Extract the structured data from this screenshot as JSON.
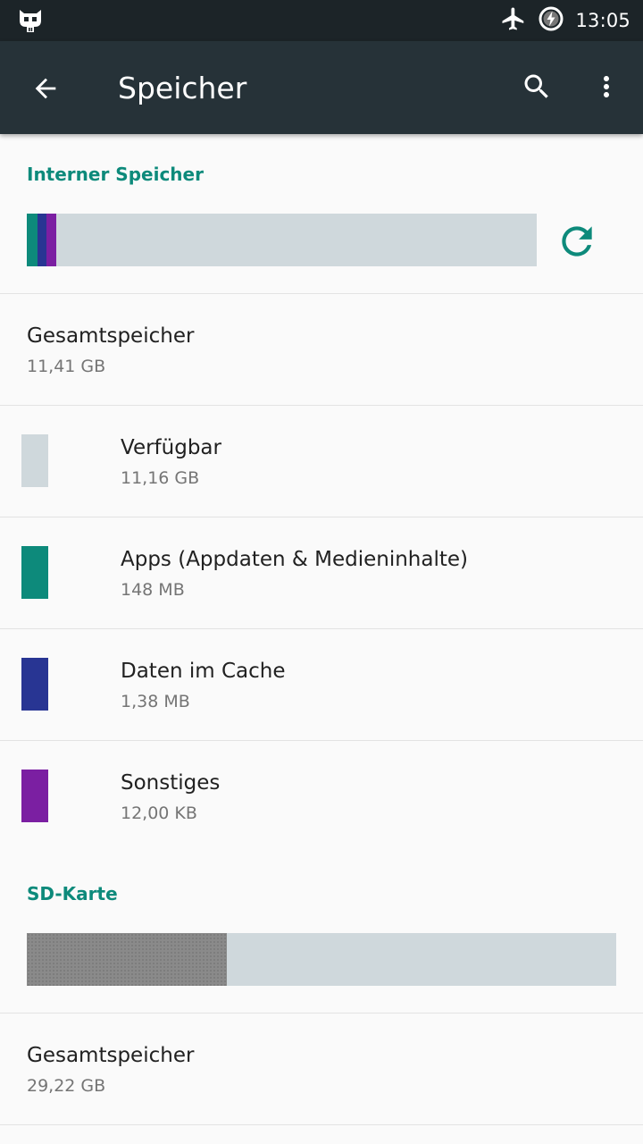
{
  "status_bar": {
    "time": "13:05",
    "left_icon": "cyanogenmod-icon",
    "right_icons": [
      "airplane-mode-icon",
      "battery-charging-icon"
    ]
  },
  "app_bar": {
    "title": "Speicher",
    "back_icon": "back-arrow-icon",
    "search_icon": "search-icon",
    "menu_icon": "more-vert-icon"
  },
  "internal_storage": {
    "header": "Interner Speicher",
    "refresh_icon": "refresh-icon",
    "usage_fractions": {
      "apps": 0.021,
      "cache": 0.018,
      "other": 0.019,
      "available": 0.942
    },
    "total": {
      "label": "Gesamtspeicher",
      "value": "11,41 GB"
    },
    "categories": [
      {
        "label": "Verfügbar",
        "value": "11,16 GB",
        "color": "#cfd8dc"
      },
      {
        "label": "Apps (Appdaten & Medieninhalte)",
        "value": "148 MB",
        "color": "#0d8a7b"
      },
      {
        "label": "Daten im Cache",
        "value": "1,38 MB",
        "color": "#283593"
      },
      {
        "label": "Sonstiges",
        "value": "12,00 KB",
        "color": "#7b1fa2"
      }
    ]
  },
  "sd_card": {
    "header": "SD-Karte",
    "used_fraction": 0.339,
    "used_color": "#8a8a8a",
    "free_color": "#cfd8dc",
    "total": {
      "label": "Gesamtspeicher",
      "value": "29,22 GB"
    }
  },
  "colors": {
    "accent": "#0d8a7b",
    "app_bar": "#263238",
    "status_bar": "#1c2428"
  }
}
